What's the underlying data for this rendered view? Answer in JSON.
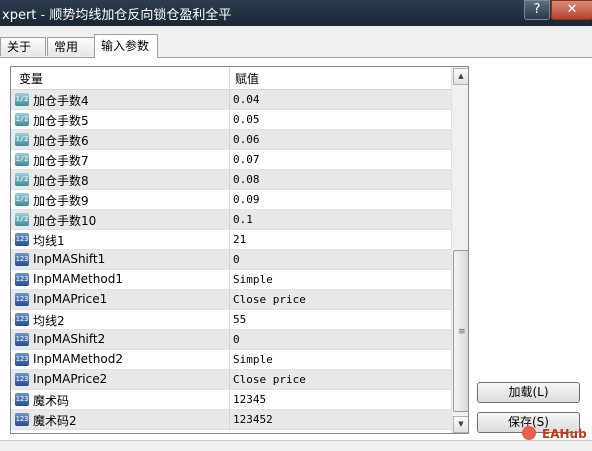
{
  "window": {
    "title": "xpert - 顺势均线加仓反向锁仓盈利全平",
    "help_label": "?",
    "close_label": "✕"
  },
  "tabs": [
    {
      "label": "关于"
    },
    {
      "label": "常用"
    },
    {
      "label": "输入参数",
      "active": true
    }
  ],
  "table": {
    "columns": [
      "变量",
      "赋值"
    ],
    "rows": [
      {
        "icon": "double-type-icon",
        "icon_text": "1/2",
        "name": "加仓手数4",
        "value": "0.04"
      },
      {
        "icon": "double-type-icon",
        "icon_text": "1/2",
        "name": "加仓手数5",
        "value": "0.05"
      },
      {
        "icon": "double-type-icon",
        "icon_text": "1/2",
        "name": "加仓手数6",
        "value": "0.06"
      },
      {
        "icon": "double-type-icon",
        "icon_text": "1/2",
        "name": "加仓手数7",
        "value": "0.07"
      },
      {
        "icon": "double-type-icon",
        "icon_text": "1/2",
        "name": "加仓手数8",
        "value": "0.08"
      },
      {
        "icon": "double-type-icon",
        "icon_text": "1/2",
        "name": "加仓手数9",
        "value": "0.09"
      },
      {
        "icon": "double-type-icon",
        "icon_text": "1/2",
        "name": "加仓手数10",
        "value": "0.1"
      },
      {
        "icon": "integer-type-icon",
        "icon_text": "123",
        "name": "均线1",
        "value": "21"
      },
      {
        "icon": "integer-type-icon",
        "icon_text": "123",
        "name": "InpMAShift1",
        "value": "0"
      },
      {
        "icon": "integer-type-icon",
        "icon_text": "123",
        "name": "InpMAMethod1",
        "value": "Simple"
      },
      {
        "icon": "integer-type-icon",
        "icon_text": "123",
        "name": "InpMAPrice1",
        "value": "Close price"
      },
      {
        "icon": "integer-type-icon",
        "icon_text": "123",
        "name": "均线2",
        "value": "55"
      },
      {
        "icon": "integer-type-icon",
        "icon_text": "123",
        "name": "InpMAShift2",
        "value": "0"
      },
      {
        "icon": "integer-type-icon",
        "icon_text": "123",
        "name": "InpMAMethod2",
        "value": "Simple"
      },
      {
        "icon": "integer-type-icon",
        "icon_text": "123",
        "name": "InpMAPrice2",
        "value": "Close price"
      },
      {
        "icon": "integer-type-icon",
        "icon_text": "123",
        "name": "魔术码",
        "value": "12345"
      },
      {
        "icon": "integer-type-icon",
        "icon_text": "123",
        "name": "魔术码2",
        "value": "123452"
      }
    ]
  },
  "buttons": {
    "load_label": "加载(L)",
    "save_label": "保存(S)"
  },
  "scrollbar": {
    "up_icon": "▲",
    "down_icon": "▼",
    "grip": "≡"
  },
  "watermark": {
    "text": "EAHub"
  }
}
